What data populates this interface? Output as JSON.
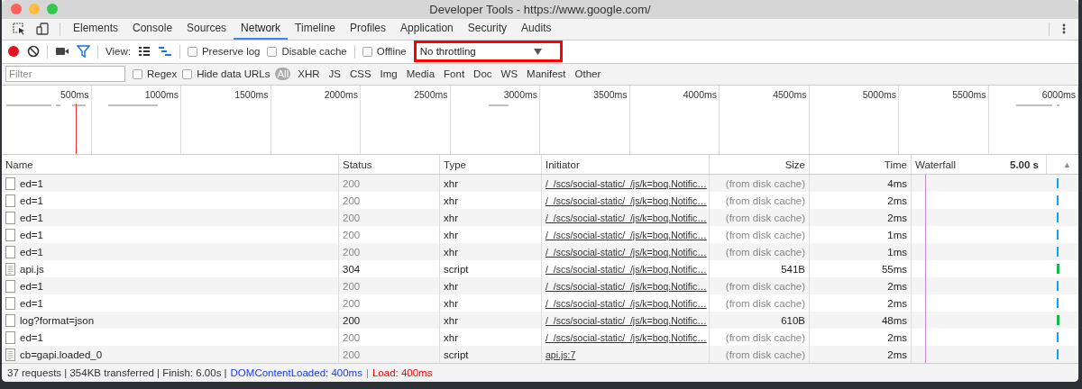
{
  "window": {
    "title": "Developer Tools - https://www.google.com/"
  },
  "tabs": [
    {
      "label": "Elements",
      "selected": false
    },
    {
      "label": "Console",
      "selected": false
    },
    {
      "label": "Sources",
      "selected": false
    },
    {
      "label": "Network",
      "selected": true
    },
    {
      "label": "Timeline",
      "selected": false
    },
    {
      "label": "Profiles",
      "selected": false
    },
    {
      "label": "Application",
      "selected": false
    },
    {
      "label": "Security",
      "selected": false
    },
    {
      "label": "Audits",
      "selected": false
    }
  ],
  "toolbar": {
    "recording": true,
    "view_label": "View:",
    "checkboxes": [
      {
        "label": "Preserve log",
        "checked": false
      },
      {
        "label": "Disable cache",
        "checked": false
      },
      {
        "label": "Offline",
        "checked": false
      }
    ],
    "throttling": {
      "value": "No throttling",
      "highlighted": true
    }
  },
  "filter_bar": {
    "placeholder": "Filter",
    "checkboxes": [
      {
        "label": "Regex",
        "checked": false
      },
      {
        "label": "Hide data URLs",
        "checked": false
      }
    ],
    "types": [
      {
        "label": "All",
        "selected": true
      },
      {
        "label": "XHR",
        "selected": false
      },
      {
        "label": "JS",
        "selected": false
      },
      {
        "label": "CSS",
        "selected": false
      },
      {
        "label": "Img",
        "selected": false
      },
      {
        "label": "Media",
        "selected": false
      },
      {
        "label": "Font",
        "selected": false
      },
      {
        "label": "Doc",
        "selected": false
      },
      {
        "label": "WS",
        "selected": false
      },
      {
        "label": "Manifest",
        "selected": false
      },
      {
        "label": "Other",
        "selected": false
      }
    ]
  },
  "overview": {
    "ticks": [
      "500ms",
      "1000ms",
      "1500ms",
      "2000ms",
      "2500ms",
      "3000ms",
      "3500ms",
      "4000ms",
      "4500ms",
      "5000ms",
      "5500ms",
      "6000ms"
    ]
  },
  "table": {
    "columns": [
      "Name",
      "Status",
      "Type",
      "Initiator",
      "Size",
      "Time",
      "Waterfall"
    ],
    "waterfall_scale": "5.00 s",
    "sort_indicator": "▲",
    "rows": [
      {
        "name": "ed=1",
        "kind": "document",
        "status": "200",
        "type": "xhr",
        "initiator": "/_/scs/social-static/_/js/k=boq.Notific…",
        "size": "(from disk cache)",
        "time": "4ms",
        "cached": true
      },
      {
        "name": "ed=1",
        "kind": "document",
        "status": "200",
        "type": "xhr",
        "initiator": "/_/scs/social-static/_/js/k=boq.Notific…",
        "size": "(from disk cache)",
        "time": "2ms",
        "cached": true
      },
      {
        "name": "ed=1",
        "kind": "document",
        "status": "200",
        "type": "xhr",
        "initiator": "/_/scs/social-static/_/js/k=boq.Notific…",
        "size": "(from disk cache)",
        "time": "2ms",
        "cached": true
      },
      {
        "name": "ed=1",
        "kind": "document",
        "status": "200",
        "type": "xhr",
        "initiator": "/_/scs/social-static/_/js/k=boq.Notific…",
        "size": "(from disk cache)",
        "time": "1ms",
        "cached": true
      },
      {
        "name": "ed=1",
        "kind": "document",
        "status": "200",
        "type": "xhr",
        "initiator": "/_/scs/social-static/_/js/k=boq.Notific…",
        "size": "(from disk cache)",
        "time": "1ms",
        "cached": true
      },
      {
        "name": "api.js",
        "kind": "script",
        "status": "304",
        "type": "script",
        "initiator": "/_/scs/social-static/_/js/k=boq.Notific…",
        "size": "541B",
        "time": "55ms",
        "cached": false
      },
      {
        "name": "ed=1",
        "kind": "document",
        "status": "200",
        "type": "xhr",
        "initiator": "/_/scs/social-static/_/js/k=boq.Notific…",
        "size": "(from disk cache)",
        "time": "2ms",
        "cached": true
      },
      {
        "name": "ed=1",
        "kind": "document",
        "status": "200",
        "type": "xhr",
        "initiator": "/_/scs/social-static/_/js/k=boq.Notific…",
        "size": "(from disk cache)",
        "time": "2ms",
        "cached": true
      },
      {
        "name": "log?format=json",
        "kind": "document",
        "status": "200",
        "type": "xhr",
        "initiator": "/_/scs/social-static/_/js/k=boq.Notific…",
        "size": "610B",
        "time": "48ms",
        "cached": false
      },
      {
        "name": "ed=1",
        "kind": "document",
        "status": "200",
        "type": "xhr",
        "initiator": "/_/scs/social-static/_/js/k=boq.Notific…",
        "size": "(from disk cache)",
        "time": "2ms",
        "cached": true
      },
      {
        "name": "cb=gapi.loaded_0",
        "kind": "script",
        "status": "200",
        "type": "script",
        "initiator": "api.js:7",
        "size": "(from disk cache)",
        "time": "2ms",
        "cached": true
      }
    ]
  },
  "status_bar": {
    "summary": "37 requests | 354KB transferred | Finish: 6.00s |",
    "dom_content_loaded": "DOMContentLoaded: 400ms",
    "separator": "|",
    "load": "Load: 400ms"
  }
}
